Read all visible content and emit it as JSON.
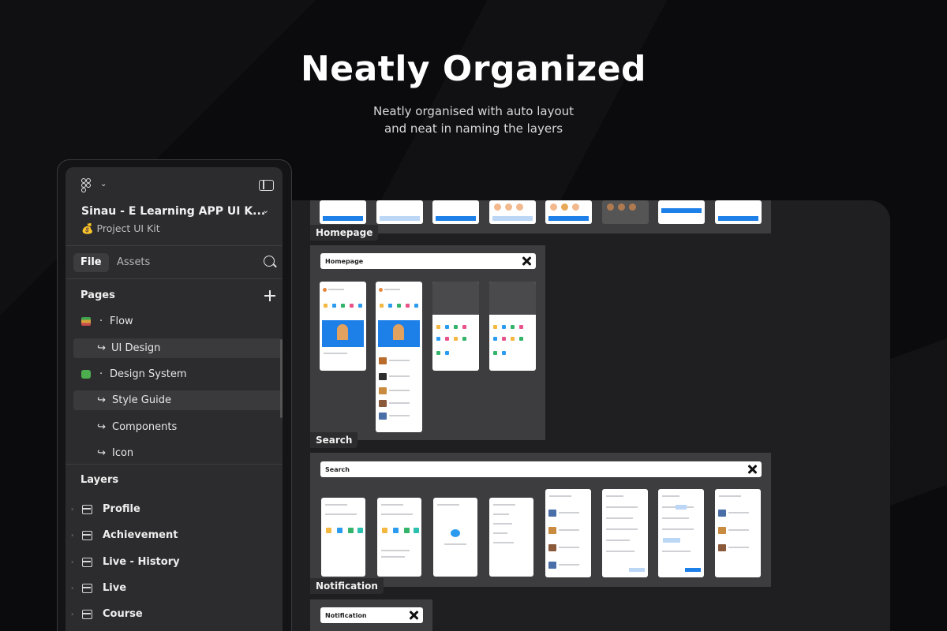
{
  "hero": {
    "title": "Neatly Organized",
    "subtitle_line1": "Neatly organised with auto layout",
    "subtitle_line2": "and neat in naming the layers"
  },
  "panel": {
    "project_title": "Sinau - E Learning APP UI K...",
    "project_subtitle": "💰 Project UI Kit",
    "tabs": [
      {
        "label": "File",
        "active": true
      },
      {
        "label": "Assets",
        "active": false
      }
    ],
    "pages_heading": "Pages",
    "pages": [
      {
        "label": "Flow",
        "prefix": "·",
        "icon": "books-icon",
        "selected": false,
        "child": false
      },
      {
        "label": "UI Design",
        "prefix": "↪",
        "selected": true,
        "child": true
      },
      {
        "label": "Design System",
        "prefix": "·",
        "icon": "puzzle-icon",
        "selected": false,
        "child": false
      },
      {
        "label": "Style Guide",
        "prefix": "↪",
        "selected": true,
        "child": true
      },
      {
        "label": "Components",
        "prefix": "↪",
        "selected": false,
        "child": true
      },
      {
        "label": "Icon",
        "prefix": "↪",
        "selected": false,
        "child": true
      }
    ],
    "layers_heading": "Layers",
    "layers": [
      "Profile",
      "Achievement",
      "Live - History",
      "Live",
      "Course"
    ]
  },
  "canvas": {
    "labels": [
      "Homepage",
      "Search",
      "Notification"
    ],
    "frame_headers": [
      "Homepage",
      "Search",
      "Notification"
    ]
  },
  "colors": {
    "background": "#0b0b0d",
    "panel": "#2c2c2e",
    "canvas": "#1f1f21",
    "frame": "#3d3d3f",
    "accent_blue": "#1d7fe8"
  }
}
